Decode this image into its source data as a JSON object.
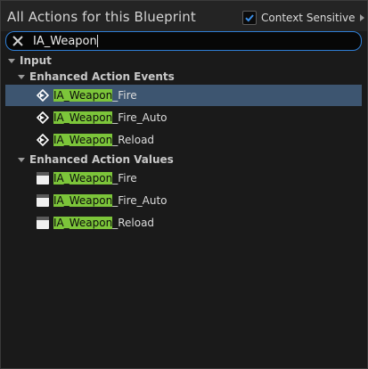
{
  "header": {
    "title": "All Actions for this Blueprint",
    "context_label": "Context Sensitive",
    "context_checked": true
  },
  "search": {
    "value": "IA_Weapon"
  },
  "tree": {
    "root": "Input",
    "events_category": "Enhanced Action Events",
    "values_category": "Enhanced Action Values",
    "events": [
      {
        "match": "IA_Weapon",
        "rest": "_Fire",
        "icon": "event-icon",
        "selected": true
      },
      {
        "match": "IA_Weapon",
        "rest": "_Fire_Auto",
        "icon": "event-icon",
        "selected": false
      },
      {
        "match": "IA_Weapon",
        "rest": "_Reload",
        "icon": "event-icon",
        "selected": false
      }
    ],
    "values": [
      {
        "match": "IA_Weapon",
        "rest": "_Fire",
        "icon": "value-node-icon"
      },
      {
        "match": "IA_Weapon",
        "rest": "_Fire_Auto",
        "icon": "value-node-icon"
      },
      {
        "match": "IA_Weapon",
        "rest": "_Reload",
        "icon": "value-node-icon"
      }
    ]
  },
  "colors": {
    "accent": "#2f7fd6",
    "highlight": "#7cc53a",
    "selection": "#3d5570"
  }
}
